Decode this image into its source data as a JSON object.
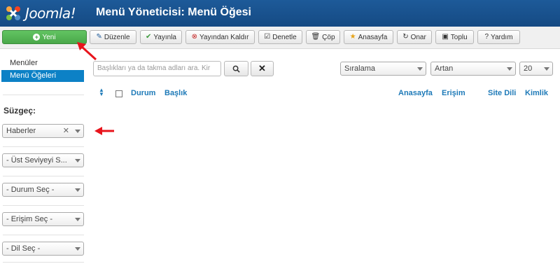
{
  "header": {
    "logo_text": "Joomla!",
    "page_title": "Menü Yöneticisi: Menü Öğesi"
  },
  "toolbar": {
    "buttons": [
      {
        "label": "Yeni",
        "icon": "plus-circle-icon"
      },
      {
        "label": "Düzenle",
        "icon": "edit-icon"
      },
      {
        "label": "Yayınla",
        "icon": "check-icon"
      },
      {
        "label": "Yayından Kaldır",
        "icon": "cancel-circle-icon"
      },
      {
        "label": "Denetle",
        "icon": "checkbox-icon"
      },
      {
        "label": "Çöp",
        "icon": "trash-icon"
      },
      {
        "label": "Anasayfa",
        "icon": "star-icon"
      },
      {
        "label": "Onar",
        "icon": "refresh-icon"
      },
      {
        "label": "Toplu",
        "icon": "batch-icon"
      },
      {
        "label": "Yardım",
        "icon": "help-icon"
      }
    ]
  },
  "sidebar": {
    "items": [
      {
        "label": "Menüler",
        "active": false
      },
      {
        "label": "Menü Öğeleri",
        "active": true
      }
    ],
    "filter_title": "Süzgeç:",
    "filters": [
      {
        "value": "Haberler",
        "clearable": true
      },
      {
        "value": "- Üst Seviyeyi S..."
      },
      {
        "value": "- Durum Seç -"
      },
      {
        "value": "- Erişim Seç -"
      },
      {
        "value": "- Dil Seç -"
      }
    ]
  },
  "search": {
    "placeholder": "Başlıkları ya da takma adları ara. Kir"
  },
  "list_controls": {
    "ordering": "Sıralama",
    "direction": "Artan",
    "limit": "20"
  },
  "table": {
    "columns": [
      "Durum",
      "Başlık",
      "Anasayfa",
      "Erişim",
      "Site Dili",
      "Kimlik"
    ]
  },
  "colors": {
    "header_blue": "#1d5a99",
    "accent_green": "#4aa84a",
    "active_blue": "#0c81c6",
    "link_blue": "#1e7ab8",
    "annotation_red": "#e8141c"
  }
}
